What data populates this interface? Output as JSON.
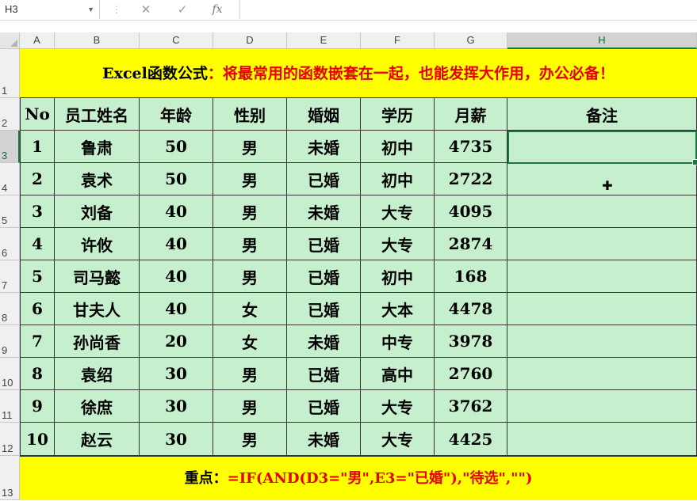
{
  "formula_bar": {
    "name_box": "H3",
    "cancel_icon": "✕",
    "enter_icon": "✓",
    "fx_label": "fx",
    "formula": ""
  },
  "columns": [
    "A",
    "B",
    "C",
    "D",
    "E",
    "F",
    "G",
    "H"
  ],
  "rows": [
    "1",
    "2",
    "3",
    "4",
    "5",
    "6",
    "7",
    "8",
    "9",
    "10",
    "11",
    "12",
    "13"
  ],
  "active_cell": "H3",
  "title": {
    "part1": "Excel函数公式",
    "part2": "：将最常用的函数嵌套在一起，也能发挥大作用，办公必备！"
  },
  "table": {
    "headers": [
      "No",
      "员工姓名",
      "年龄",
      "性别",
      "婚姻",
      "学历",
      "月薪",
      "备注"
    ],
    "rows": [
      [
        "1",
        "鲁肃",
        "50",
        "男",
        "未婚",
        "初中",
        "4735",
        ""
      ],
      [
        "2",
        "袁术",
        "50",
        "男",
        "已婚",
        "初中",
        "2722",
        ""
      ],
      [
        "3",
        "刘备",
        "40",
        "男",
        "未婚",
        "大专",
        "4095",
        ""
      ],
      [
        "4",
        "许攸",
        "40",
        "男",
        "已婚",
        "大专",
        "2874",
        ""
      ],
      [
        "5",
        "司马懿",
        "40",
        "男",
        "已婚",
        "初中",
        "168",
        ""
      ],
      [
        "6",
        "甘夫人",
        "40",
        "女",
        "已婚",
        "大本",
        "4478",
        ""
      ],
      [
        "7",
        "孙尚香",
        "20",
        "女",
        "未婚",
        "中专",
        "3978",
        ""
      ],
      [
        "8",
        "袁绍",
        "30",
        "男",
        "已婚",
        "高中",
        "2760",
        ""
      ],
      [
        "9",
        "徐庶",
        "30",
        "男",
        "已婚",
        "大专",
        "3762",
        ""
      ],
      [
        "10",
        "赵云",
        "30",
        "男",
        "未婚",
        "大专",
        "4425",
        ""
      ]
    ]
  },
  "note": {
    "label": "重点：",
    "formula": "=IF(AND(D3=\"男\",E3=\"已婚\"),\"待选\",\"\")"
  },
  "colors": {
    "title_bg": "#ffff00",
    "accent_red": "#e60000",
    "cell_green": "#c6efce",
    "excel_green": "#217346"
  }
}
